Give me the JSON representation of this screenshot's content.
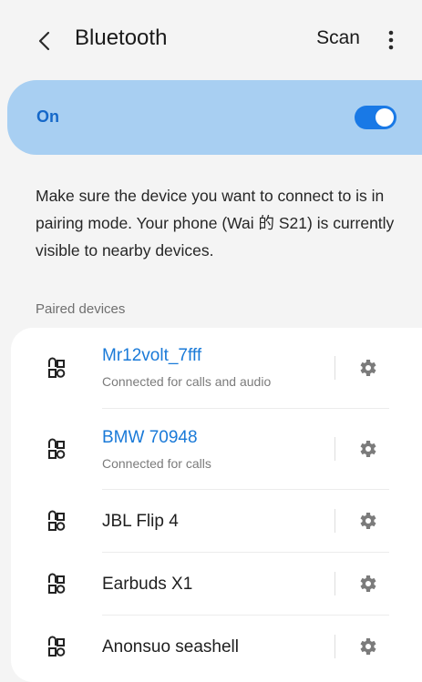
{
  "header": {
    "title": "Bluetooth",
    "scan_label": "Scan",
    "back_icon": "chevron-left-icon",
    "more_icon": "more-vertical-icon"
  },
  "bluetooth_toggle": {
    "label": "On",
    "state": true,
    "accent_color": "#1979e6"
  },
  "helper_text": "Make sure the device you want to connect to is in pairing mode. Your phone (Wai 的 S21) is currently visible to nearby devices.",
  "paired_section": {
    "title": "Paired devices",
    "devices": [
      {
        "name": "Mr12volt_7fff",
        "status": "Connected for calls and audio",
        "connected": true
      },
      {
        "name": "BMW 70948",
        "status": "Connected for calls",
        "connected": true
      },
      {
        "name": "JBL Flip 4",
        "status": "",
        "connected": false
      },
      {
        "name": "Earbuds X1",
        "status": "",
        "connected": false
      },
      {
        "name": "Anonsuo seashell",
        "status": "",
        "connected": false
      }
    ]
  },
  "colors": {
    "connected_text": "#1a7ad8",
    "on_card_bg": "#a8cff2",
    "page_bg": "#f4f4f4"
  }
}
